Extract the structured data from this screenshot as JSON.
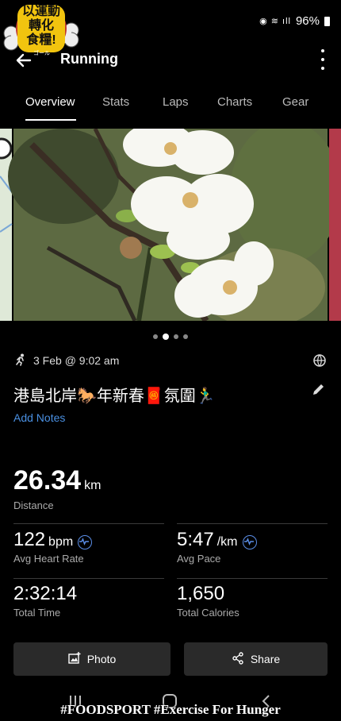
{
  "status": {
    "battery": "96%"
  },
  "logo": {
    "line1": "以運動",
    "line2": "轉化",
    "line3": "食糧!",
    "sub": "ゴール"
  },
  "header": {
    "title": "Running"
  },
  "tabs": [
    {
      "label": "Overview",
      "active": true
    },
    {
      "label": "Stats"
    },
    {
      "label": "Laps"
    },
    {
      "label": "Charts"
    },
    {
      "label": "Gear"
    }
  ],
  "carousel": {
    "dots": 4,
    "active_index": 1
  },
  "activity": {
    "datetime": "3 Feb @ 9:02 am",
    "name": "港島北岸🐎年新春🧧氛圍🏃‍♂️",
    "add_notes": "Add Notes"
  },
  "stats": {
    "distance": {
      "value": "26.34",
      "unit": "km",
      "label": "Distance"
    },
    "heart_rate": {
      "value": "122",
      "unit": "bpm",
      "label": "Avg Heart Rate"
    },
    "pace": {
      "value": "5:47",
      "unit": "/km",
      "label": "Avg Pace"
    },
    "time": {
      "value": "2:32:14",
      "label": "Total Time"
    },
    "calories": {
      "value": "1,650",
      "label": "Total Calories"
    }
  },
  "buttons": {
    "photo": "Photo",
    "share": "Share"
  },
  "caption": "#FOODSPORT #Exercise For Hunger",
  "colors": {
    "accent": "#4a90e2",
    "background": "#000000",
    "button": "#2a2a2a"
  }
}
